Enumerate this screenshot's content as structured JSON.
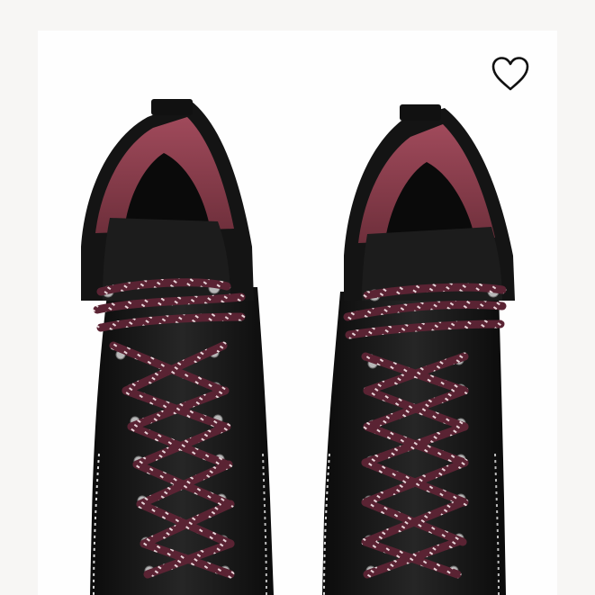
{
  "product": {
    "image_icon": "hiking-boots-photo",
    "colors": {
      "leather": "#121212",
      "lining": "#8a3c4b",
      "lace": "#5a2333",
      "lace_fleck": "#e9d6da",
      "eyelet": "#b8b8b8",
      "stitching": "#d9d9d9",
      "background": "#f7f6f4"
    }
  },
  "wishlist": {
    "icon": "heart-outline-icon",
    "state": "not-favorited"
  }
}
